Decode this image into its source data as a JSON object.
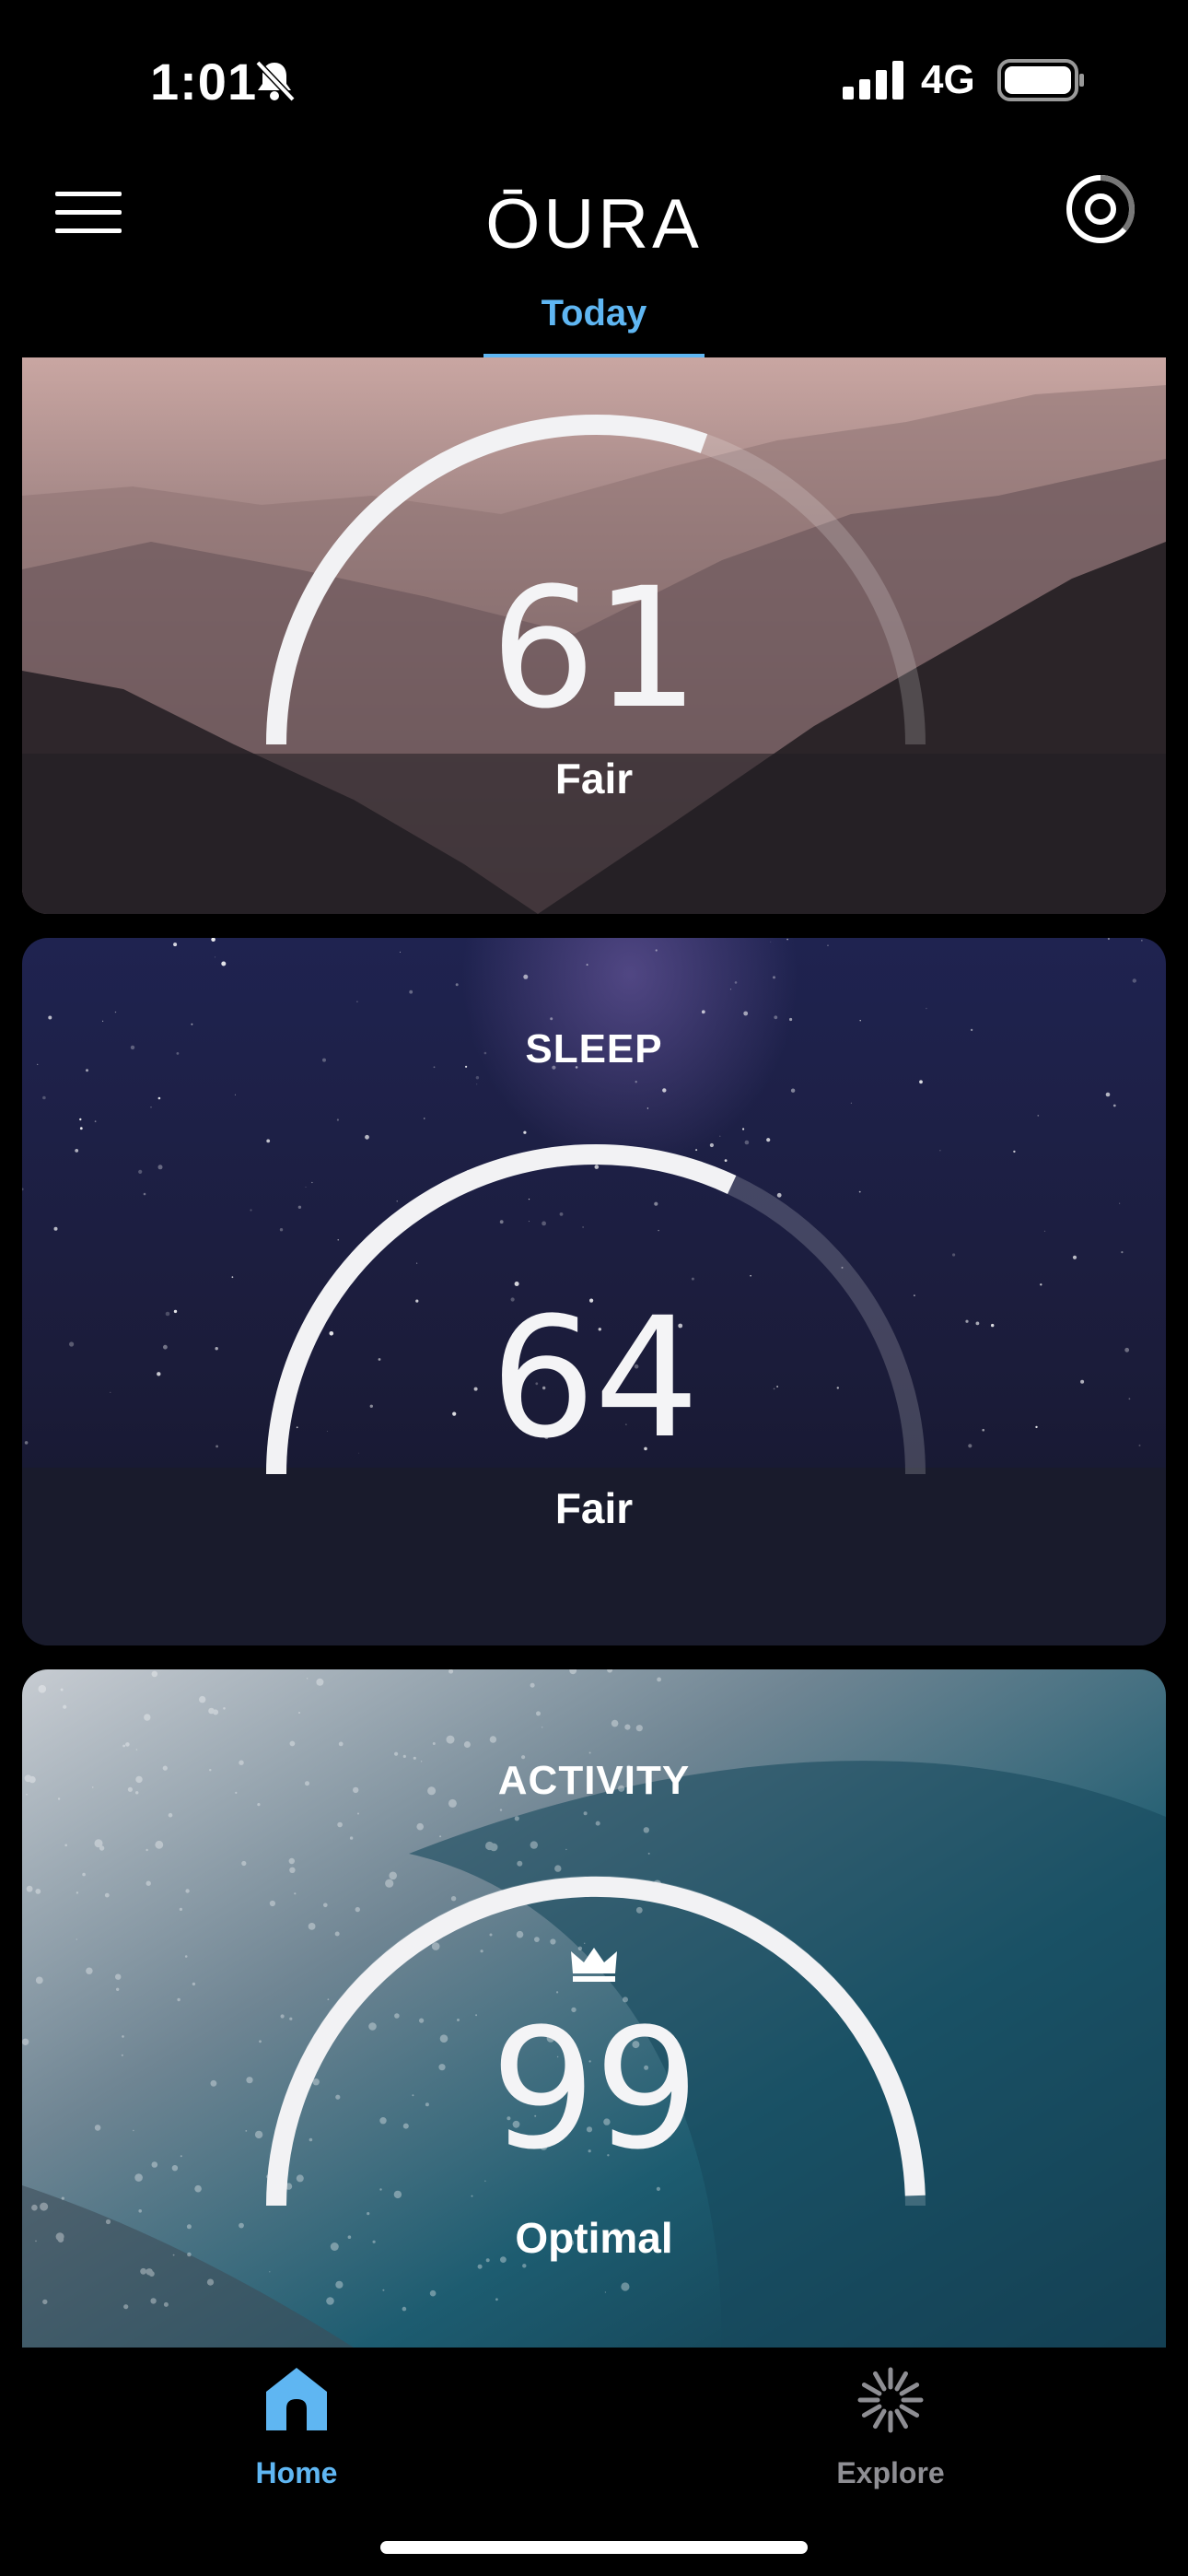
{
  "status_bar": {
    "time": "1:01",
    "network": "4G"
  },
  "header": {
    "logo": "ŌURA",
    "tab_today": "Today"
  },
  "cards": {
    "readiness": {
      "score": "61",
      "status": "Fair",
      "progress": 0.61
    },
    "sleep": {
      "title": "SLEEP",
      "score": "64",
      "status": "Fair",
      "progress": 0.64
    },
    "activity": {
      "title": "ACTIVITY",
      "score": "99",
      "status": "Optimal",
      "progress": 0.99
    }
  },
  "bottom_nav": {
    "home_label": "Home",
    "explore_label": "Explore",
    "active_color": "#5fb6f2",
    "inactive_color": "#8e8e93"
  }
}
